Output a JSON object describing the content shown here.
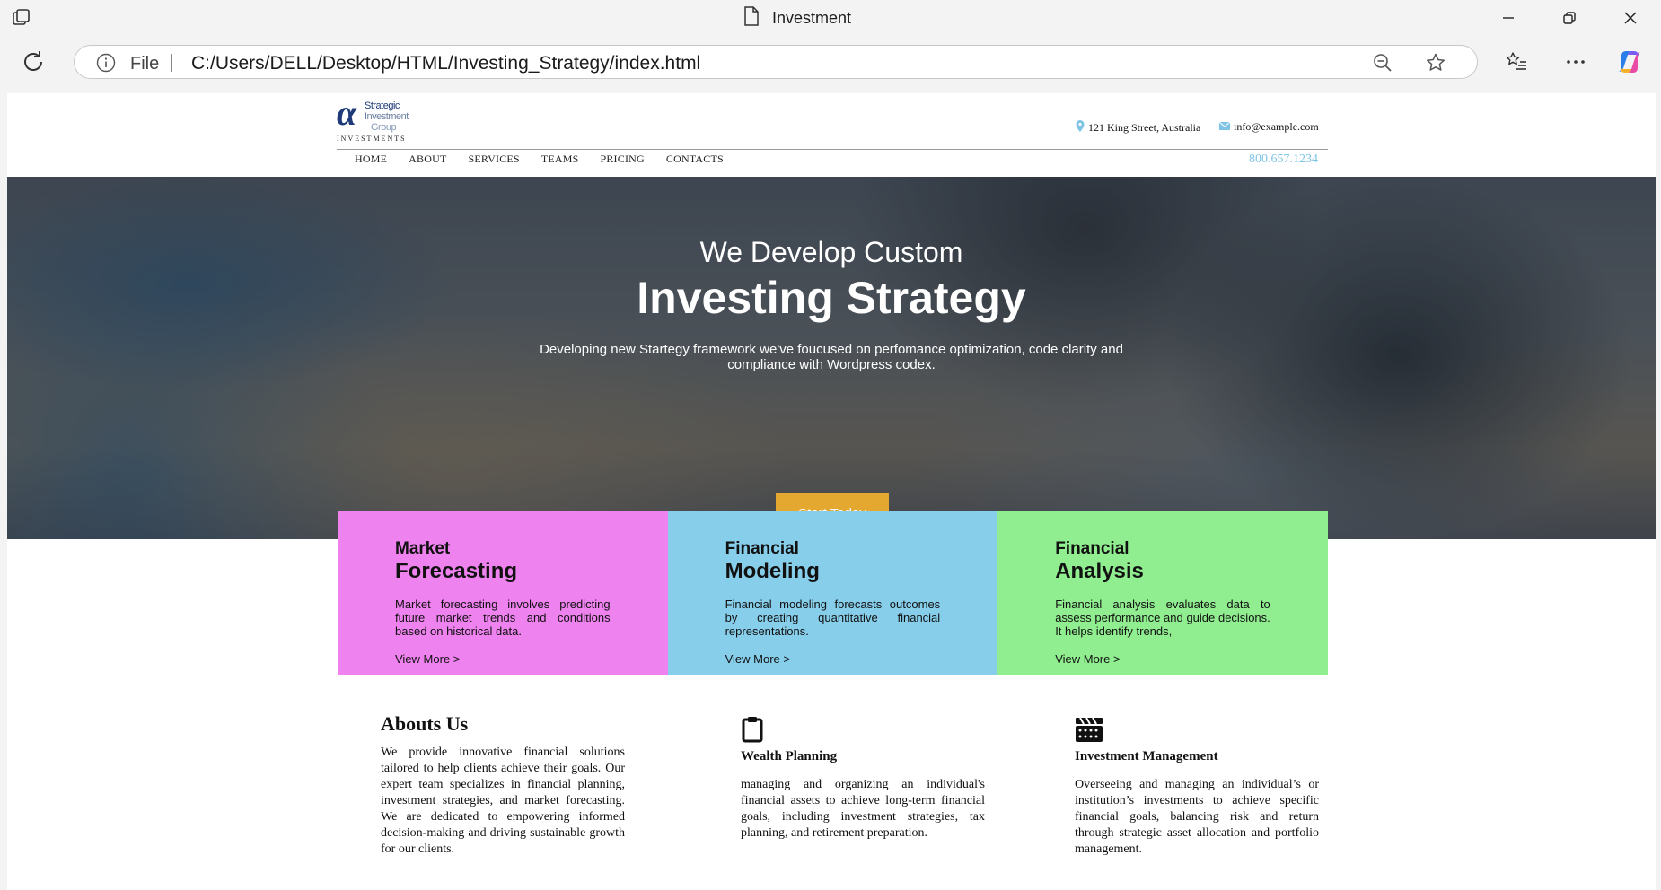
{
  "browser": {
    "tab_title": "Investment",
    "url_scheme_label": "File",
    "url": "C:/Users/DELL/Desktop/HTML/Investing_Strategy/index.html"
  },
  "site": {
    "logo": {
      "line1": "Strategic",
      "line2": "Investment",
      "line3": "Group",
      "line4": "INVESTMENTS"
    },
    "address": "121 King Street, Australia",
    "email": "info@example.com",
    "phone": "800.657.1234",
    "nav": [
      "HOME",
      "ABOUT",
      "SERVICES",
      "TEAMS",
      "PRICING",
      "CONTACTS"
    ]
  },
  "hero": {
    "subtitle": "We Develop Custom",
    "title": "Investing Strategy",
    "description": "Developing new Startegy framework we've foucused on perfomance optimization, code clarity and compliance with Wordpress codex.",
    "button": "Start Today"
  },
  "cards": [
    {
      "top": "Market",
      "title": "Forecasting",
      "text": "Market forecasting involves predicting future market trends and conditions based on historical data.",
      "link": "View More >",
      "color": "#ee82ee"
    },
    {
      "top": "Financial",
      "title": "Modeling",
      "text": "Financial modeling forecasts outcomes by creating quantitative financial representations.",
      "link": "View More >",
      "color": "#87ceeb"
    },
    {
      "top": "Financial",
      "title": "Analysis",
      "text": "Financial analysis evaluates data to assess performance and guide decisions. It helps identify trends,",
      "link": "View More >",
      "color": "#90ee90"
    }
  ],
  "about": {
    "title": "Abouts Us",
    "text": "We provide innovative financial solutions tailored to help clients achieve their goals. Our expert team specializes in financial planning, investment strategies, and market forecasting. We are dedicated to empowering informed decision-making and driving sustainable growth for our clients."
  },
  "wealth": {
    "icon": "clipboard-icon",
    "title": "Wealth Planning",
    "text": "managing and organizing an individual's financial assets to achieve long-term financial goals, including investment strategies, tax planning, and retirement preparation."
  },
  "investment": {
    "icon": "film-clapper-icon",
    "title": "Investment Management",
    "text": "Overseeing and managing an individual’s or institution’s investments to achieve specific financial goals, balancing risk and return through strategic asset allocation and portfolio management."
  }
}
